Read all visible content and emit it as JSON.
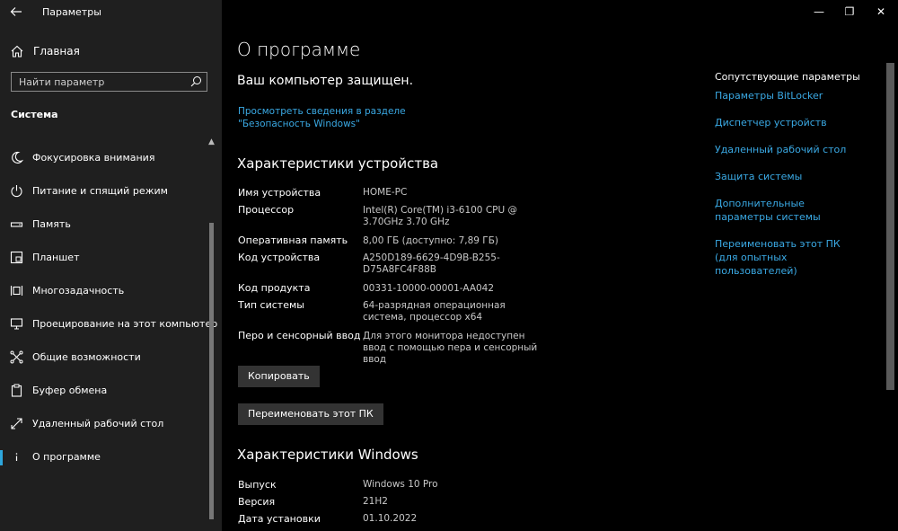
{
  "window": {
    "title": "Параметры",
    "back_icon": "arrow-left-icon",
    "controls": {
      "minimize": "—",
      "maximize": "❐",
      "close": "✕"
    }
  },
  "sidebar": {
    "home_label": "Главная",
    "search_placeholder": "Найти параметр",
    "section_heading": "Система",
    "items": [
      {
        "label": "Фокусировка внимания",
        "icon": "moon-icon"
      },
      {
        "label": "Питание и спящий режим",
        "icon": "power-icon"
      },
      {
        "label": "Память",
        "icon": "storage-icon"
      },
      {
        "label": "Планшет",
        "icon": "tablet-icon"
      },
      {
        "label": "Многозадачность",
        "icon": "multitasking-icon"
      },
      {
        "label": "Проецирование на этот компьютер",
        "icon": "projecting-icon"
      },
      {
        "label": "Общие возможности",
        "icon": "shared-experiences-icon"
      },
      {
        "label": "Буфер обмена",
        "icon": "clipboard-icon"
      },
      {
        "label": "Удаленный рабочий стол",
        "icon": "remote-desktop-icon"
      },
      {
        "label": "О программе",
        "icon": "info-icon",
        "selected": true
      }
    ]
  },
  "main": {
    "title": "О программе",
    "protected_text": "Ваш компьютер защищен.",
    "security_link": "Просмотреть сведения в разделе \"Безопасность Windows\"",
    "device_specs": {
      "heading": "Характеристики устройства",
      "rows": [
        {
          "label": "Имя устройства",
          "value": "HOME-PC"
        },
        {
          "label": "Процессор",
          "value": "Intel(R) Core(TM) i3-6100 CPU @ 3.70GHz 3.70 GHz"
        },
        {
          "label": "Оперативная память",
          "value": "8,00 ГБ (доступно: 7,89 ГБ)"
        },
        {
          "label": "Код устройства",
          "value": "A250D189-6629-4D9B-B255-D75A8FC4F88B"
        },
        {
          "label": "Код продукта",
          "value": "00331-10000-00001-AA042"
        },
        {
          "label": "Тип системы",
          "value": "64-разрядная операционная система, процессор x64"
        },
        {
          "label": "Перо и сенсорный ввод",
          "value": "Для этого монитора недоступен ввод с помощью пера и сенсорный ввод"
        }
      ],
      "copy_button": "Копировать",
      "rename_button": "Переименовать этот ПК"
    },
    "windows_specs": {
      "heading": "Характеристики Windows",
      "rows": [
        {
          "label": "Выпуск",
          "value": "Windows 10 Pro"
        },
        {
          "label": "Версия",
          "value": "21H2"
        },
        {
          "label": "Дата установки",
          "value": "01.10.2022"
        }
      ]
    }
  },
  "related": {
    "heading": "Сопутствующие параметры",
    "links": [
      "Параметры BitLocker",
      "Диспетчер устройств",
      "Удаленный рабочий стол",
      "Защита системы",
      "Дополнительные параметры системы",
      "Переименовать этот ПК (для опытных пользователей)"
    ]
  },
  "colors": {
    "accent": "#3aa9e4",
    "sidebar_bg": "#1f1f1f",
    "main_bg": "#000000",
    "button_bg": "#333333"
  }
}
